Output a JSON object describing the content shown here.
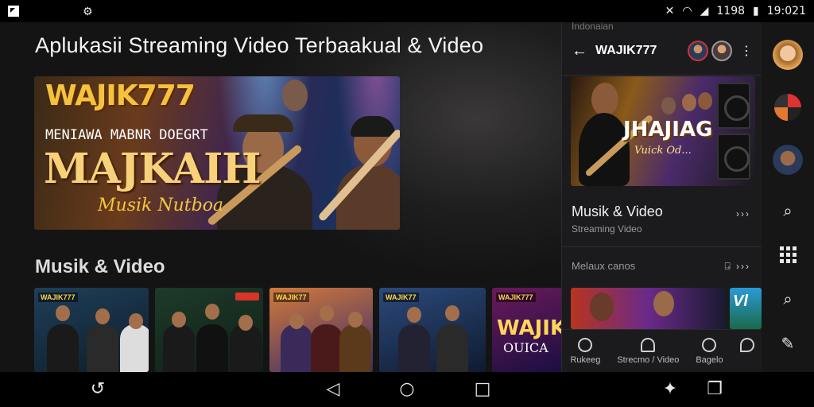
{
  "status_bar": {
    "time": "19:021",
    "battery": "1198",
    "icons": [
      "screenshot-icon",
      "app-icon",
      "mute-icon",
      "wifi-icon",
      "signal-icon",
      "battery-icon"
    ]
  },
  "main": {
    "page_title": "Aplukasii Streaming Video Terbaakual & Video",
    "hero": {
      "logo": "WAJIK777",
      "tagline": "MENIAWA MABNR DOEGRT",
      "headline": "MAJKAIH",
      "script": "Musik Nutboa"
    },
    "section_title": "Musik & Video",
    "thumbnails": [
      {
        "logo": "WAJIK777"
      },
      {
        "logo": ""
      },
      {
        "logo": "WAJIK77"
      },
      {
        "logo": "WAJIK77"
      },
      {
        "logo": "WAJIK777",
        "title": "WAJIK",
        "subtitle": "OUICA"
      }
    ]
  },
  "panel": {
    "top_text": "Indonaian",
    "title": "WAJIK777",
    "banner": {
      "text": "JHAJIAG",
      "subtitle": "Vuick Od..."
    },
    "item_title": "Musik & Video",
    "item_sub": "Streaming Video",
    "item_chevron": "›››",
    "section_title": "Melaux canos",
    "section_chevron": "⍈ ›››",
    "thumb_text": "Vl",
    "nav": [
      {
        "label": "Rukeeg"
      },
      {
        "label": "Strecmo / Video"
      },
      {
        "label": "Bagelo"
      }
    ]
  },
  "rail": {
    "icons": [
      "avatar",
      "logo",
      "avatar",
      "search-icon",
      "grid-icon",
      "search-icon",
      "edit-icon"
    ]
  },
  "colors": {
    "background": "#141415",
    "accent_gold": "#f6c23e",
    "panel_bg": "#1b1b1d"
  }
}
